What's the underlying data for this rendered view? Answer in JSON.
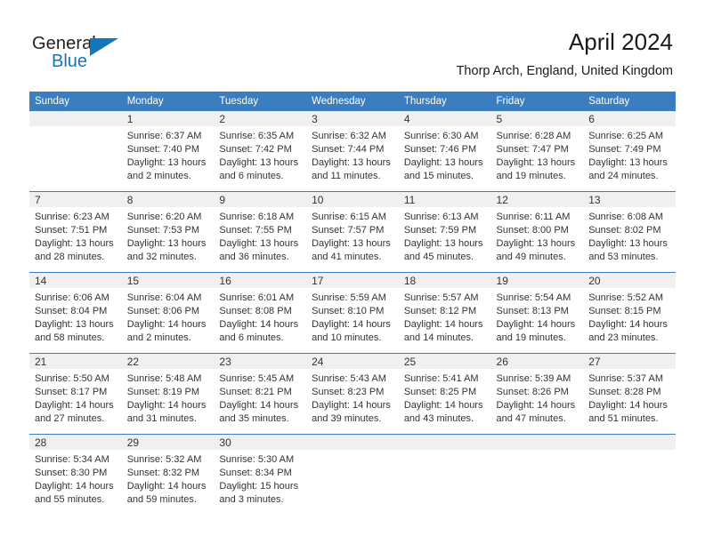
{
  "brand": {
    "name_part1": "General",
    "name_part2": "Blue",
    "triangle_icon": "triangle-icon",
    "colors": {
      "blue": "#1676bc",
      "dark": "#231f20"
    }
  },
  "header": {
    "title": "April 2024",
    "subtitle": "Thorp Arch, England, United Kingdom"
  },
  "calendar": {
    "header_bg": "#3a7ebf",
    "daynum_band_bg": "#f0f0f0",
    "weekday_headers": [
      "Sunday",
      "Monday",
      "Tuesday",
      "Wednesday",
      "Thursday",
      "Friday",
      "Saturday"
    ],
    "weeks": [
      [
        {
          "day": "",
          "sunrise": "",
          "sunset": "",
          "daylight_line1": "",
          "daylight_line2": "",
          "empty": true
        },
        {
          "day": "1",
          "sunrise": "Sunrise: 6:37 AM",
          "sunset": "Sunset: 7:40 PM",
          "daylight_line1": "Daylight: 13 hours",
          "daylight_line2": "and 2 minutes."
        },
        {
          "day": "2",
          "sunrise": "Sunrise: 6:35 AM",
          "sunset": "Sunset: 7:42 PM",
          "daylight_line1": "Daylight: 13 hours",
          "daylight_line2": "and 6 minutes."
        },
        {
          "day": "3",
          "sunrise": "Sunrise: 6:32 AM",
          "sunset": "Sunset: 7:44 PM",
          "daylight_line1": "Daylight: 13 hours",
          "daylight_line2": "and 11 minutes."
        },
        {
          "day": "4",
          "sunrise": "Sunrise: 6:30 AM",
          "sunset": "Sunset: 7:46 PM",
          "daylight_line1": "Daylight: 13 hours",
          "daylight_line2": "and 15 minutes."
        },
        {
          "day": "5",
          "sunrise": "Sunrise: 6:28 AM",
          "sunset": "Sunset: 7:47 PM",
          "daylight_line1": "Daylight: 13 hours",
          "daylight_line2": "and 19 minutes."
        },
        {
          "day": "6",
          "sunrise": "Sunrise: 6:25 AM",
          "sunset": "Sunset: 7:49 PM",
          "daylight_line1": "Daylight: 13 hours",
          "daylight_line2": "and 24 minutes."
        }
      ],
      [
        {
          "day": "7",
          "sunrise": "Sunrise: 6:23 AM",
          "sunset": "Sunset: 7:51 PM",
          "daylight_line1": "Daylight: 13 hours",
          "daylight_line2": "and 28 minutes."
        },
        {
          "day": "8",
          "sunrise": "Sunrise: 6:20 AM",
          "sunset": "Sunset: 7:53 PM",
          "daylight_line1": "Daylight: 13 hours",
          "daylight_line2": "and 32 minutes."
        },
        {
          "day": "9",
          "sunrise": "Sunrise: 6:18 AM",
          "sunset": "Sunset: 7:55 PM",
          "daylight_line1": "Daylight: 13 hours",
          "daylight_line2": "and 36 minutes."
        },
        {
          "day": "10",
          "sunrise": "Sunrise: 6:15 AM",
          "sunset": "Sunset: 7:57 PM",
          "daylight_line1": "Daylight: 13 hours",
          "daylight_line2": "and 41 minutes."
        },
        {
          "day": "11",
          "sunrise": "Sunrise: 6:13 AM",
          "sunset": "Sunset: 7:59 PM",
          "daylight_line1": "Daylight: 13 hours",
          "daylight_line2": "and 45 minutes."
        },
        {
          "day": "12",
          "sunrise": "Sunrise: 6:11 AM",
          "sunset": "Sunset: 8:00 PM",
          "daylight_line1": "Daylight: 13 hours",
          "daylight_line2": "and 49 minutes."
        },
        {
          "day": "13",
          "sunrise": "Sunrise: 6:08 AM",
          "sunset": "Sunset: 8:02 PM",
          "daylight_line1": "Daylight: 13 hours",
          "daylight_line2": "and 53 minutes."
        }
      ],
      [
        {
          "day": "14",
          "sunrise": "Sunrise: 6:06 AM",
          "sunset": "Sunset: 8:04 PM",
          "daylight_line1": "Daylight: 13 hours",
          "daylight_line2": "and 58 minutes."
        },
        {
          "day": "15",
          "sunrise": "Sunrise: 6:04 AM",
          "sunset": "Sunset: 8:06 PM",
          "daylight_line1": "Daylight: 14 hours",
          "daylight_line2": "and 2 minutes."
        },
        {
          "day": "16",
          "sunrise": "Sunrise: 6:01 AM",
          "sunset": "Sunset: 8:08 PM",
          "daylight_line1": "Daylight: 14 hours",
          "daylight_line2": "and 6 minutes."
        },
        {
          "day": "17",
          "sunrise": "Sunrise: 5:59 AM",
          "sunset": "Sunset: 8:10 PM",
          "daylight_line1": "Daylight: 14 hours",
          "daylight_line2": "and 10 minutes."
        },
        {
          "day": "18",
          "sunrise": "Sunrise: 5:57 AM",
          "sunset": "Sunset: 8:12 PM",
          "daylight_line1": "Daylight: 14 hours",
          "daylight_line2": "and 14 minutes."
        },
        {
          "day": "19",
          "sunrise": "Sunrise: 5:54 AM",
          "sunset": "Sunset: 8:13 PM",
          "daylight_line1": "Daylight: 14 hours",
          "daylight_line2": "and 19 minutes."
        },
        {
          "day": "20",
          "sunrise": "Sunrise: 5:52 AM",
          "sunset": "Sunset: 8:15 PM",
          "daylight_line1": "Daylight: 14 hours",
          "daylight_line2": "and 23 minutes."
        }
      ],
      [
        {
          "day": "21",
          "sunrise": "Sunrise: 5:50 AM",
          "sunset": "Sunset: 8:17 PM",
          "daylight_line1": "Daylight: 14 hours",
          "daylight_line2": "and 27 minutes."
        },
        {
          "day": "22",
          "sunrise": "Sunrise: 5:48 AM",
          "sunset": "Sunset: 8:19 PM",
          "daylight_line1": "Daylight: 14 hours",
          "daylight_line2": "and 31 minutes."
        },
        {
          "day": "23",
          "sunrise": "Sunrise: 5:45 AM",
          "sunset": "Sunset: 8:21 PM",
          "daylight_line1": "Daylight: 14 hours",
          "daylight_line2": "and 35 minutes."
        },
        {
          "day": "24",
          "sunrise": "Sunrise: 5:43 AM",
          "sunset": "Sunset: 8:23 PM",
          "daylight_line1": "Daylight: 14 hours",
          "daylight_line2": "and 39 minutes."
        },
        {
          "day": "25",
          "sunrise": "Sunrise: 5:41 AM",
          "sunset": "Sunset: 8:25 PM",
          "daylight_line1": "Daylight: 14 hours",
          "daylight_line2": "and 43 minutes."
        },
        {
          "day": "26",
          "sunrise": "Sunrise: 5:39 AM",
          "sunset": "Sunset: 8:26 PM",
          "daylight_line1": "Daylight: 14 hours",
          "daylight_line2": "and 47 minutes."
        },
        {
          "day": "27",
          "sunrise": "Sunrise: 5:37 AM",
          "sunset": "Sunset: 8:28 PM",
          "daylight_line1": "Daylight: 14 hours",
          "daylight_line2": "and 51 minutes."
        }
      ],
      [
        {
          "day": "28",
          "sunrise": "Sunrise: 5:34 AM",
          "sunset": "Sunset: 8:30 PM",
          "daylight_line1": "Daylight: 14 hours",
          "daylight_line2": "and 55 minutes."
        },
        {
          "day": "29",
          "sunrise": "Sunrise: 5:32 AM",
          "sunset": "Sunset: 8:32 PM",
          "daylight_line1": "Daylight: 14 hours",
          "daylight_line2": "and 59 minutes."
        },
        {
          "day": "30",
          "sunrise": "Sunrise: 5:30 AM",
          "sunset": "Sunset: 8:34 PM",
          "daylight_line1": "Daylight: 15 hours",
          "daylight_line2": "and 3 minutes."
        },
        {
          "day": "",
          "sunrise": "",
          "sunset": "",
          "daylight_line1": "",
          "daylight_line2": "",
          "empty": true
        },
        {
          "day": "",
          "sunrise": "",
          "sunset": "",
          "daylight_line1": "",
          "daylight_line2": "",
          "empty": true
        },
        {
          "day": "",
          "sunrise": "",
          "sunset": "",
          "daylight_line1": "",
          "daylight_line2": "",
          "empty": true
        },
        {
          "day": "",
          "sunrise": "",
          "sunset": "",
          "daylight_line1": "",
          "daylight_line2": "",
          "empty": true
        }
      ]
    ]
  }
}
